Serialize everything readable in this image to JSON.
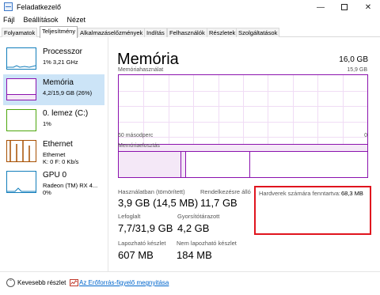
{
  "window": {
    "title": "Feladatkezelő"
  },
  "menu": [
    "Fájl",
    "Beállítások",
    "Nézet"
  ],
  "tabs": [
    "Folyamatok",
    "Teljesítmény",
    "Alkalmazáselőzmények",
    "Indítás",
    "Felhasználók",
    "Részletek",
    "Szolgáltatások"
  ],
  "active_tab": "Teljesítmény",
  "sidebar": [
    {
      "name": "Processzor",
      "sub": "1% 3,21 GHz",
      "color": "#117dbb",
      "selected": false
    },
    {
      "name": "Memória",
      "sub": "4,2/15,9 GB (26%)",
      "color": "#8b12ae",
      "selected": true
    },
    {
      "name": "0. lemez (C:)",
      "sub": "1%",
      "color": "#4da60c",
      "selected": false
    },
    {
      "name": "Ethernet",
      "sub": "Ethernet\nK: 0 F: 0 Kb/s",
      "color": "#a74f01",
      "selected": false
    },
    {
      "name": "GPU 0",
      "sub": "Radeon (TM) RX 4...\n0%",
      "color": "#117dbb",
      "selected": false
    }
  ],
  "main": {
    "title": "Memória",
    "total": "16,0 GB",
    "usage_label": "Memóriahasználat",
    "usage_max": "15,9 GB",
    "usage_level": 0.26,
    "time_left": "60 másodperc",
    "time_right": "0",
    "composition_label": "Memóriaelosztás",
    "stats": {
      "in_use_label": "Használatban (tömörített)",
      "in_use_value": "3,9 GB (14,5 MB)",
      "available_label": "Rendelkezésre álló",
      "available_value": "11,7 GB",
      "committed_label": "Lefoglalt",
      "committed_value": "7,7/31,9 GB",
      "cached_label": "Gyorsítótárazott",
      "cached_value": "4,2 GB",
      "paged_label": "Lapozható készlet",
      "paged_value": "607 MB",
      "nonpaged_label": "Nem lapozható készlet",
      "nonpaged_value": "184 MB",
      "hw_reserved_label": "Hardverek számára fenntartva:",
      "hw_reserved_value": "68,3 MB"
    }
  },
  "footer": {
    "fewer_details": "Kevesebb részlet",
    "resource_monitor": "Az Erőforrás-figyelő megnyitása"
  },
  "colors": {
    "memory_accent": "#8b12ae",
    "highlight_box": "#e0141e",
    "selected_bg": "#cce4f7",
    "link": "#0066cc"
  }
}
